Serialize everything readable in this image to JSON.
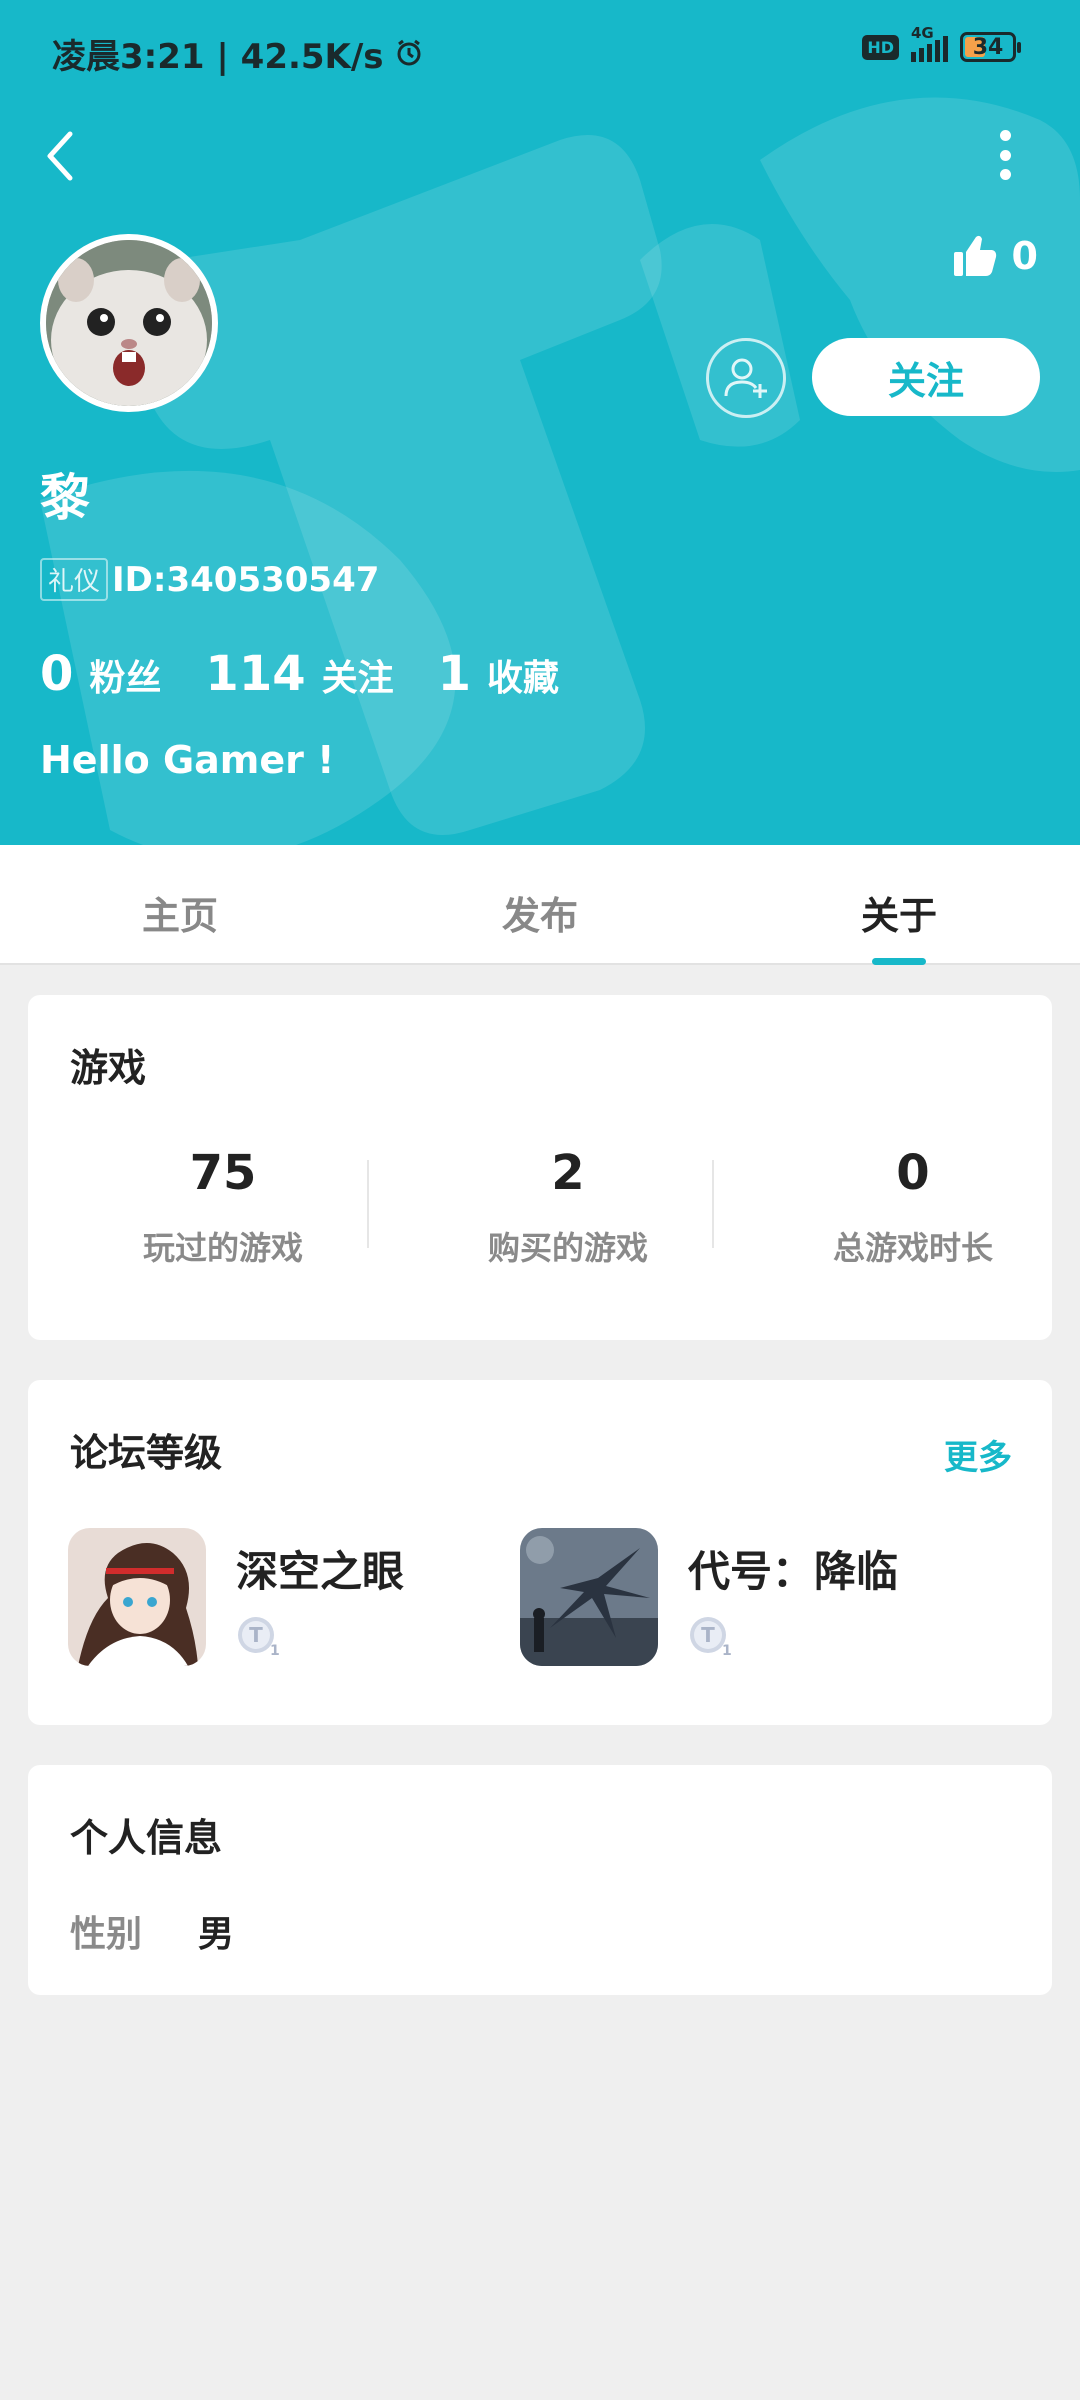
{
  "status_bar": {
    "left_text": "凌晨3:21 | 42.5K/s",
    "hd": "HD",
    "network": "4G",
    "battery": "34"
  },
  "header": {
    "likes": "0",
    "follow_label": "关注",
    "username": "黎",
    "badge": "礼仪",
    "user_id": "ID:340530547",
    "stats": [
      {
        "value": "0",
        "label": "粉丝"
      },
      {
        "value": "114",
        "label": "关注"
      },
      {
        "value": "1",
        "label": "收藏"
      }
    ],
    "bio": "Hello Gamer !"
  },
  "tabs": [
    {
      "label": "主页"
    },
    {
      "label": "发布"
    },
    {
      "label": "关于"
    }
  ],
  "active_tab": "关于",
  "games_card": {
    "title": "游戏",
    "stats": [
      {
        "value": "75",
        "label": "玩过的游戏"
      },
      {
        "value": "2",
        "label": "购买的游戏"
      },
      {
        "value": "0",
        "label": "总游戏时长"
      }
    ]
  },
  "forum_card": {
    "title": "论坛等级",
    "more_label": "更多",
    "games": [
      {
        "name": "深空之眼"
      },
      {
        "name": "代号：降临"
      }
    ]
  },
  "personal_card": {
    "title": "个人信息",
    "gender_key": "性别",
    "gender_value": "男"
  },
  "colors": {
    "accent": "#17b8c9",
    "background": "#efefef"
  }
}
